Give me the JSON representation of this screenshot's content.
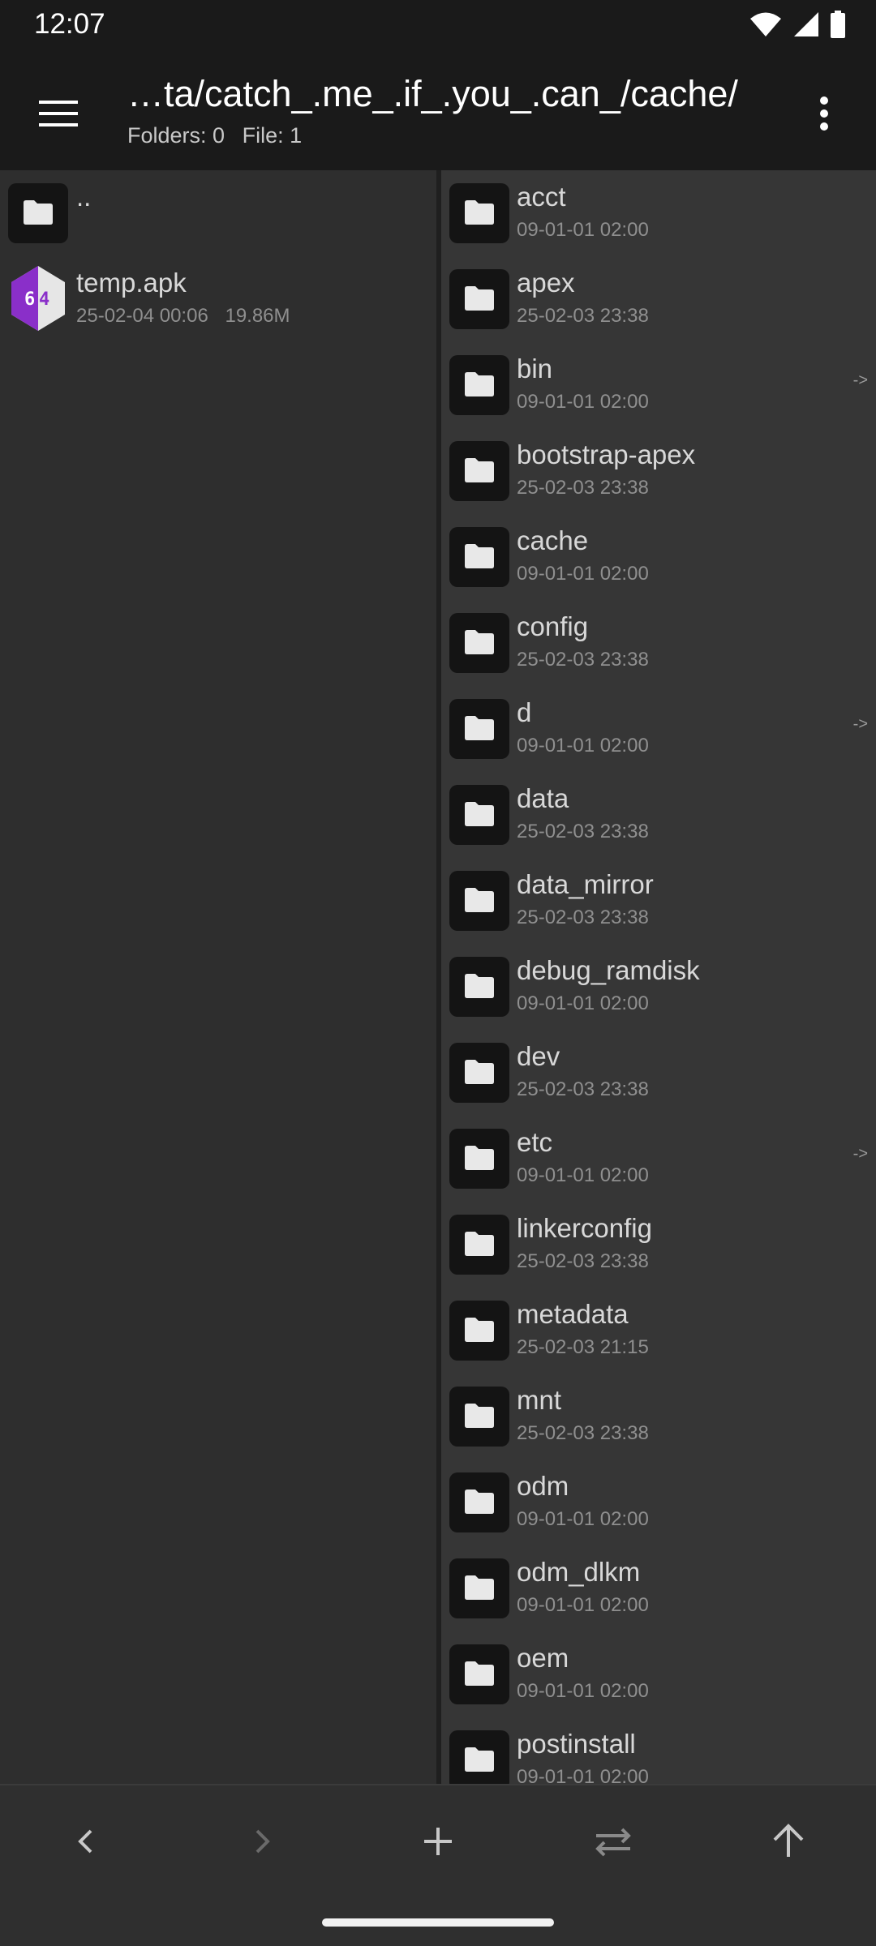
{
  "status": {
    "time": "12:07",
    "icons": [
      "wifi-icon",
      "signal-icon",
      "battery-icon"
    ]
  },
  "header": {
    "path": "…ta/catch_.me_.if_.you_.can_/cache/",
    "folders_text": "Folders: 0",
    "files_text": "File: 1",
    "menu_icon": "hamburger-menu-icon",
    "more_icon": "more-vert-icon"
  },
  "left_pane": {
    "items": [
      {
        "name": "..",
        "meta_date": "",
        "meta_size": "",
        "icon": "folder-icon"
      },
      {
        "name": "temp.apk",
        "meta_date": "25-02-04 00:06",
        "meta_size": "19.86M",
        "icon": "apk-icon"
      }
    ]
  },
  "right_pane": {
    "items": [
      {
        "name": "acct",
        "date": "09-01-01 02:00",
        "link": ""
      },
      {
        "name": "apex",
        "date": "25-02-03 23:38",
        "link": ""
      },
      {
        "name": "bin",
        "date": "09-01-01 02:00",
        "link": "->"
      },
      {
        "name": "bootstrap-apex",
        "date": "25-02-03 23:38",
        "link": ""
      },
      {
        "name": "cache",
        "date": "09-01-01 02:00",
        "link": ""
      },
      {
        "name": "config",
        "date": "25-02-03 23:38",
        "link": ""
      },
      {
        "name": "d",
        "date": "09-01-01 02:00",
        "link": "->"
      },
      {
        "name": "data",
        "date": "25-02-03 23:38",
        "link": ""
      },
      {
        "name": "data_mirror",
        "date": "25-02-03 23:38",
        "link": ""
      },
      {
        "name": "debug_ramdisk",
        "date": "09-01-01 02:00",
        "link": ""
      },
      {
        "name": "dev",
        "date": "25-02-03 23:38",
        "link": ""
      },
      {
        "name": "etc",
        "date": "09-01-01 02:00",
        "link": "->"
      },
      {
        "name": "linkerconfig",
        "date": "25-02-03 23:38",
        "link": ""
      },
      {
        "name": "metadata",
        "date": "25-02-03 21:15",
        "link": ""
      },
      {
        "name": "mnt",
        "date": "25-02-03 23:38",
        "link": ""
      },
      {
        "name": "odm",
        "date": "09-01-01 02:00",
        "link": ""
      },
      {
        "name": "odm_dlkm",
        "date": "09-01-01 02:00",
        "link": ""
      },
      {
        "name": "oem",
        "date": "09-01-01 02:00",
        "link": ""
      },
      {
        "name": "postinstall",
        "date": "09-01-01 02:00",
        "link": ""
      }
    ]
  },
  "bottom_bar": {
    "buttons": [
      "back-arrow-icon",
      "forward-arrow-icon",
      "add-icon",
      "swap-icon",
      "up-arrow-icon"
    ]
  },
  "colors": {
    "bar_bg": "#1a1a1a",
    "left_pane_bg": "#2e2e2e",
    "right_pane_bg": "#363636",
    "folder_tile_bg": "#141414",
    "apk_accent": "#8a2fc9"
  }
}
